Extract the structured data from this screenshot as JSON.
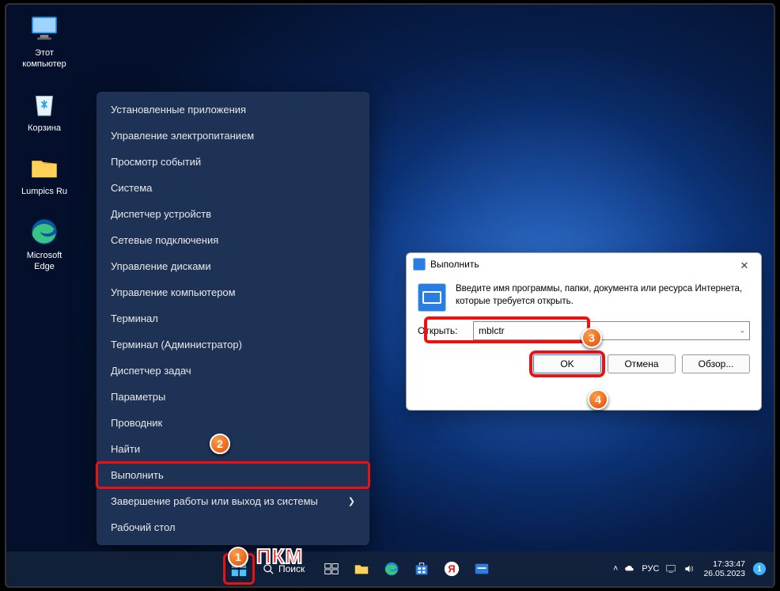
{
  "desktop": {
    "icons": [
      {
        "id": "this-pc",
        "label": "Этот\nкомпьютер"
      },
      {
        "id": "recycle",
        "label": "Корзина"
      },
      {
        "id": "folder",
        "label": "Lumpics Ru"
      },
      {
        "id": "edge",
        "label": "Microsoft\nEdge"
      }
    ]
  },
  "ctx": {
    "items": [
      {
        "label": "Установленные приложения",
        "sub": false
      },
      {
        "label": "Управление электропитанием",
        "sub": false
      },
      {
        "label": "Просмотр событий",
        "sub": false
      },
      {
        "label": "Система",
        "sub": false
      },
      {
        "label": "Диспетчер устройств",
        "sub": false
      },
      {
        "label": "Сетевые подключения",
        "sub": false
      },
      {
        "label": "Управление дисками",
        "sub": false
      },
      {
        "label": "Управление компьютером",
        "sub": false
      },
      {
        "label": "Терминал",
        "sub": false
      },
      {
        "label": "Терминал (Администратор)",
        "sub": false
      },
      {
        "label": "Диспетчер задач",
        "sub": false
      },
      {
        "label": "Параметры",
        "sub": false
      },
      {
        "label": "Проводник",
        "sub": false
      },
      {
        "label": "Найти",
        "sub": false
      },
      {
        "label": "Выполнить",
        "sub": false,
        "hl": true
      },
      {
        "label": "Завершение работы или выход из системы",
        "sub": true
      },
      {
        "label": "Рабочий стол",
        "sub": false
      }
    ]
  },
  "run": {
    "title": "Выполнить",
    "desc": "Введите имя программы, папки, документа или ресурса Интернета, которые требуется открыть.",
    "open_label": "Открыть:",
    "value": "mblctr",
    "ok": "OK",
    "cancel": "Отмена",
    "browse": "Обзор..."
  },
  "taskbar": {
    "search": "Поиск",
    "lang": "РУС",
    "time": "17:33:47",
    "date": "26.05.2023",
    "noti": "1"
  },
  "annot": {
    "pkm": "ПКМ"
  }
}
